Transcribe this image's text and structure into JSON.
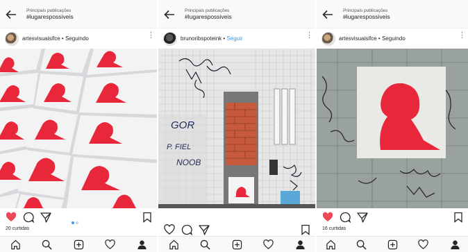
{
  "posts": [
    {
      "header": {
        "subtitle": "Principais publicações",
        "hashtag": "#lugarespossiveis"
      },
      "user": {
        "name": "artesvisuaisifce",
        "separator": "•",
        "follow_label": "Seguindo",
        "follow_state": "following"
      },
      "liked": true,
      "likes_text": "20 curtidas",
      "carousel": true
    },
    {
      "header": {
        "subtitle": "Principais publicações",
        "hashtag": "#lugarespossiveis"
      },
      "user": {
        "name": "brunoribspoteink",
        "separator": "•",
        "follow_label": "Seguir",
        "follow_state": "not-following"
      },
      "liked": false,
      "likes_text": "",
      "graffiti_text": [
        "GOR",
        "P. FIEL",
        "NOOB"
      ]
    },
    {
      "header": {
        "subtitle": "Principais publicações",
        "hashtag": "#lugarespossiveis"
      },
      "user": {
        "name": "artesvisuaisifce",
        "separator": "•",
        "follow_label": "Seguindo",
        "follow_state": "following"
      },
      "liked": true,
      "likes_text": "16 curtidas"
    }
  ],
  "colors": {
    "like_red": "#ed4956",
    "link_blue": "#3897f0",
    "stencil_red": "#e8283a"
  },
  "icons": {
    "topbar": "back-arrow-icon",
    "actions": [
      "heart-icon",
      "comment-icon",
      "share-icon",
      "bookmark-icon"
    ],
    "navbar": [
      "home-icon",
      "search-icon",
      "add-post-icon",
      "activity-heart-icon",
      "profile-icon"
    ]
  }
}
